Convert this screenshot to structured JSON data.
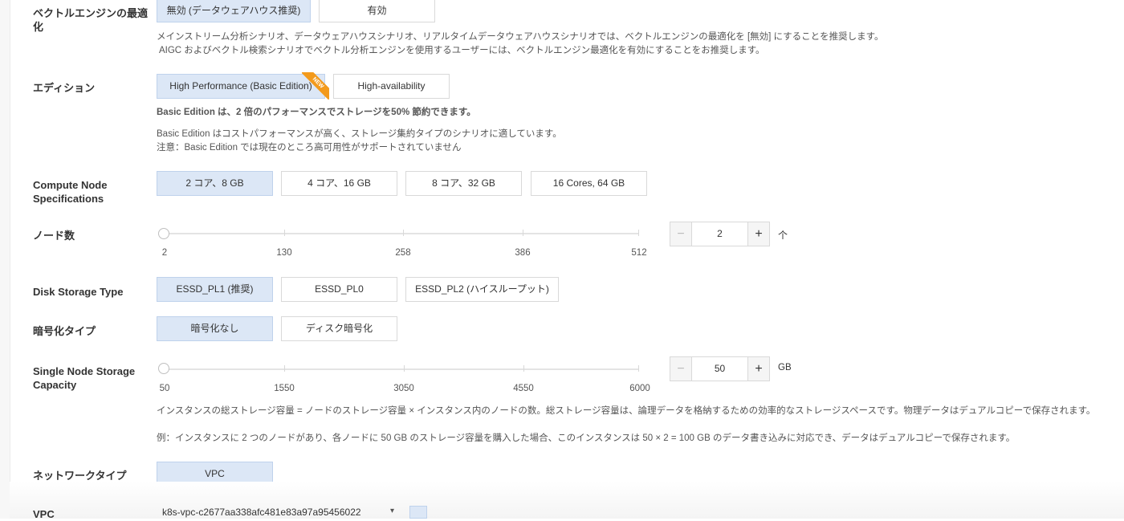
{
  "vector_engine": {
    "label": "ベクトルエンジンの最適化",
    "options": [
      "無効 (データウェアハウス推奨)",
      "有効"
    ],
    "selected": 0,
    "hint1": "メインストリーム分析シナリオ、データウェアハウスシナリオ、リアルタイムデータウェアハウスシナリオでは、ベクトルエンジンの最適化を [無効] にすることを推奨します。",
    "hint2": "AIGC およびベクトル検索シナリオでベクトル分析エンジンを使用するユーザーには、ベクトルエンジン最適化を有効にすることをお推奨します。"
  },
  "edition": {
    "label": "エディション",
    "options": [
      "High Performance (Basic Edition)",
      "High-availability"
    ],
    "selected": 0,
    "badge": "NEW",
    "bold_hint": "Basic Edition は、2 倍のパフォーマンスでストレージを50% 節約できます。",
    "hint1": "Basic Edition はコストパフォーマンスが高く、ストレージ集約タイプのシナリオに適しています。",
    "hint2": "注意：Basic Edition では現在のところ高可用性がサポートされていません"
  },
  "compute": {
    "label": "Compute Node Specifications",
    "options": [
      "2 コア、8 GB",
      "4 コア、16 GB",
      "8 コア、32 GB",
      "16 Cores, 64 GB"
    ],
    "selected": 0
  },
  "nodes": {
    "label": "ノード数",
    "ticks": [
      "2",
      "130",
      "258",
      "386",
      "512"
    ],
    "min": 2,
    "max": 512,
    "value": "2",
    "unit": "个",
    "minus": "−",
    "plus": "+"
  },
  "disk_type": {
    "label": "Disk Storage Type",
    "options": [
      "ESSD_PL1 (推奨)",
      "ESSD_PL0",
      "ESSD_PL2 (ハイスループット)"
    ],
    "selected": 0
  },
  "encryption": {
    "label": "暗号化タイプ",
    "options": [
      "暗号化なし",
      "ディスク暗号化"
    ],
    "selected": 0
  },
  "storage": {
    "label": "Single Node Storage Capacity",
    "ticks": [
      "50",
      "1550",
      "3050",
      "4550",
      "6000"
    ],
    "min": 50,
    "max": 6000,
    "value": "50",
    "unit": "GB",
    "minus": "−",
    "plus": "+",
    "hint1": "インスタンスの総ストレージ容量 = ノードのストレージ容量 × インスタンス内のノードの数。総ストレージ容量は、論理データを格納するための効率的なストレージスペースです。物理データはデュアルコピーで保存されます。",
    "hint2": "例：インスタンスに 2 つのノードがあり、各ノードに 50 GB のストレージ容量を購入した場合、このインスタンスは 50 × 2 = 100 GB のデータ書き込みに対応でき、データはデュアルコピーで保存されます。"
  },
  "network": {
    "label": "ネットワークタイプ",
    "options": [
      "VPC"
    ],
    "selected": 0
  },
  "vpc": {
    "label": "VPC",
    "value": "k8s-vpc-c2677aa338afc481e83a97a95456022"
  },
  "colors": {
    "selected_bg": "#dce7f6",
    "badge": "#f39a1c",
    "accent": "#2f7bd6"
  }
}
